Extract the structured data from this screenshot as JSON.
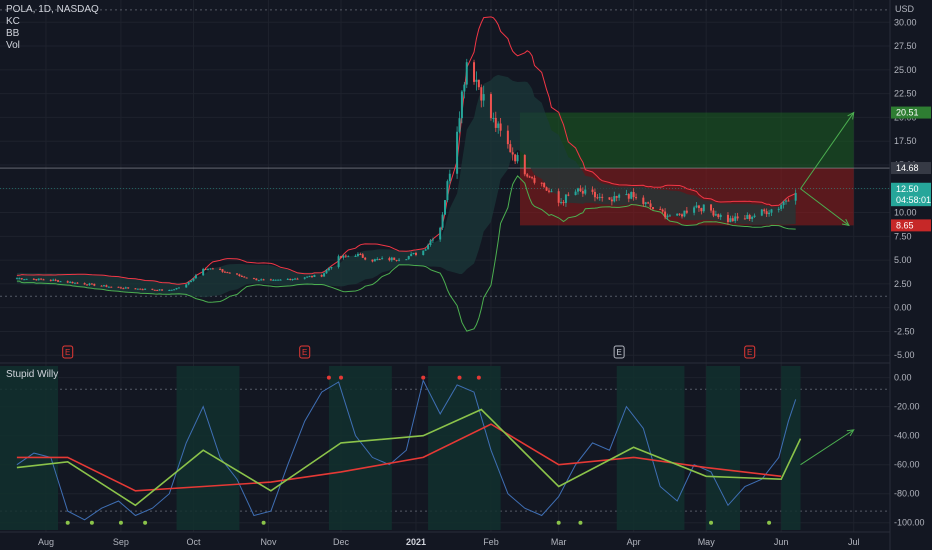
{
  "header": {
    "symbol_line": "POLA, 1D, NASDAQ",
    "indicators": [
      "KC",
      "BB",
      "Vol"
    ],
    "currency": "USD"
  },
  "lower_pane": {
    "title": "Stupid Willy"
  },
  "colors": {
    "background": "#131722",
    "grid": "#1e222d",
    "candle_up": "#26a69a",
    "candle_down": "#ef5350",
    "bb_upper": "#f23645",
    "bb_lower": "#4caf50",
    "kc_fill": "#1b3a3a",
    "signal_red": "#e53935",
    "signal_green": "#8bc34a",
    "osc_blue": "#3f6fb5",
    "profit_zone": "#1b5e20",
    "loss_zone": "#8b1a1a",
    "arrow": "#4caf50"
  },
  "chart_data": [
    {
      "type": "candlestick",
      "title": "POLA, 1D, NASDAQ",
      "xlabel": "",
      "ylabel": "USD",
      "x_ticks": [
        "Aug",
        "Sep",
        "Oct",
        "Nov",
        "Dec",
        "2021",
        "Feb",
        "Mar",
        "Apr",
        "May",
        "Jun",
        "Jul"
      ],
      "y_ticks": [
        "30.00",
        "27.50",
        "25.00",
        "22.50",
        "20.00",
        "17.50",
        "15.00",
        "12.50",
        "10.00",
        "7.50",
        "5.00",
        "2.50",
        "0.00",
        "-2.50",
        "-5.00"
      ],
      "ylim": [
        -5.5,
        31.5
      ],
      "price_tags": [
        {
          "label": "20.51",
          "value": 20.51,
          "color": "#2e7d32"
        },
        {
          "label": "14.68",
          "value": 14.68,
          "color": "#363a45"
        },
        {
          "label": "12.50",
          "value": 12.5,
          "color": "#26a69a"
        },
        {
          "label": "04:58:01",
          "value": 11.3,
          "color": "#26a69a"
        },
        {
          "label": "8.65",
          "value": 8.65,
          "color": "#c62828"
        }
      ],
      "earnings_markers": [
        {
          "label": "E",
          "date": "2020-08-10",
          "style": "red"
        },
        {
          "label": "E",
          "date": "2020-11-16",
          "style": "red"
        },
        {
          "label": "E",
          "date": "2021-03-26",
          "style": "grey"
        },
        {
          "label": "E",
          "date": "2021-05-19",
          "style": "red"
        }
      ],
      "close_series": [
        [
          "2020-07-20",
          3.1
        ],
        [
          "2020-07-27",
          3.0
        ],
        [
          "2020-08-03",
          2.9
        ],
        [
          "2020-08-10",
          2.7
        ],
        [
          "2020-08-17",
          2.5
        ],
        [
          "2020-08-24",
          2.3
        ],
        [
          "2020-08-31",
          2.1
        ],
        [
          "2020-09-07",
          2.0
        ],
        [
          "2020-09-14",
          1.9
        ],
        [
          "2020-09-21",
          1.8
        ],
        [
          "2020-09-28",
          2.4
        ],
        [
          "2020-10-05",
          4.2
        ],
        [
          "2020-10-12",
          3.9
        ],
        [
          "2020-10-19",
          3.4
        ],
        [
          "2020-10-26",
          3.0
        ],
        [
          "2020-11-02",
          2.8
        ],
        [
          "2020-11-09",
          3.0
        ],
        [
          "2020-11-16",
          3.2
        ],
        [
          "2020-11-23",
          3.4
        ],
        [
          "2020-11-30",
          5.2
        ],
        [
          "2020-12-07",
          5.6
        ],
        [
          "2020-12-14",
          5.0
        ],
        [
          "2020-12-21",
          5.1
        ],
        [
          "2020-12-28",
          5.3
        ],
        [
          "2021-01-04",
          6.0
        ],
        [
          "2021-01-11",
          8.5
        ],
        [
          "2021-01-18",
          19.0
        ],
        [
          "2021-01-22",
          26.0
        ],
        [
          "2021-01-26",
          24.0
        ],
        [
          "2021-02-01",
          20.0
        ],
        [
          "2021-02-08",
          17.0
        ],
        [
          "2021-02-15",
          14.5
        ],
        [
          "2021-02-22",
          13.0
        ],
        [
          "2021-03-01",
          11.0
        ],
        [
          "2021-03-08",
          12.2
        ],
        [
          "2021-03-15",
          11.8
        ],
        [
          "2021-03-22",
          11.0
        ],
        [
          "2021-03-29",
          12.0
        ],
        [
          "2021-04-05",
          11.0
        ],
        [
          "2021-04-12",
          10.0
        ],
        [
          "2021-04-19",
          9.5
        ],
        [
          "2021-04-26",
          10.8
        ],
        [
          "2021-05-03",
          10.2
        ],
        [
          "2021-05-10",
          9.2
        ],
        [
          "2021-05-17",
          9.4
        ],
        [
          "2021-05-24",
          10.0
        ],
        [
          "2021-05-31",
          10.6
        ],
        [
          "2021-06-07",
          12.5
        ]
      ],
      "annotations": [
        {
          "type": "projection_arrow",
          "from": [
            "2021-06-09",
            12.5
          ],
          "to": [
            "2021-07-01",
            20.51
          ]
        },
        {
          "type": "projection_arrow",
          "from": [
            "2021-06-09",
            12.5
          ],
          "to": [
            "2021-06-29",
            8.65
          ]
        },
        {
          "type": "target_zone",
          "from_date": "2021-02-13",
          "to_date": "2021-07-01",
          "low": 14.68,
          "high": 20.51
        },
        {
          "type": "stop_zone",
          "from_date": "2021-02-13",
          "to_date": "2021-07-01",
          "low": 8.65,
          "high": 14.68
        }
      ]
    },
    {
      "type": "line",
      "title": "Stupid Willy",
      "xlabel": "",
      "ylabel": "",
      "y_ticks": [
        "0.00",
        "-20.00",
        "-40.00",
        "-60.00",
        "-80.00",
        "-100.00"
      ],
      "ylim": [
        -105,
        8
      ],
      "series": [
        {
          "color": "#3f6fb5",
          "points": [
            [
              "2020-07-20",
              -60
            ],
            [
              "2020-07-27",
              -52
            ],
            [
              "2020-08-03",
              -55
            ],
            [
              "2020-08-10",
              -92
            ],
            [
              "2020-08-17",
              -98
            ],
            [
              "2020-08-24",
              -90
            ],
            [
              "2020-08-31",
              -85
            ],
            [
              "2020-09-07",
              -95
            ],
            [
              "2020-09-14",
              -90
            ],
            [
              "2020-09-21",
              -80
            ],
            [
              "2020-09-28",
              -45
            ],
            [
              "2020-10-05",
              -20
            ],
            [
              "2020-10-12",
              -55
            ],
            [
              "2020-10-19",
              -70
            ],
            [
              "2020-10-26",
              -95
            ],
            [
              "2020-11-02",
              -92
            ],
            [
              "2020-11-09",
              -60
            ],
            [
              "2020-11-16",
              -30
            ],
            [
              "2020-11-23",
              -10
            ],
            [
              "2020-11-30",
              -3
            ],
            [
              "2020-12-07",
              -40
            ],
            [
              "2020-12-14",
              -55
            ],
            [
              "2020-12-21",
              -60
            ],
            [
              "2020-12-28",
              -50
            ],
            [
              "2021-01-04",
              -2
            ],
            [
              "2021-01-11",
              -25
            ],
            [
              "2021-01-18",
              -5
            ],
            [
              "2021-01-25",
              -10
            ],
            [
              "2021-02-01",
              -50
            ],
            [
              "2021-02-08",
              -80
            ],
            [
              "2021-02-15",
              -90
            ],
            [
              "2021-02-22",
              -95
            ],
            [
              "2021-03-01",
              -82
            ],
            [
              "2021-03-08",
              -60
            ],
            [
              "2021-03-15",
              -45
            ],
            [
              "2021-03-22",
              -50
            ],
            [
              "2021-03-29",
              -20
            ],
            [
              "2021-04-05",
              -35
            ],
            [
              "2021-04-12",
              -75
            ],
            [
              "2021-04-19",
              -85
            ],
            [
              "2021-04-26",
              -60
            ],
            [
              "2021-05-03",
              -65
            ],
            [
              "2021-05-10",
              -88
            ],
            [
              "2021-05-17",
              -75
            ],
            [
              "2021-05-24",
              -70
            ],
            [
              "2021-05-31",
              -55
            ],
            [
              "2021-06-04",
              -30
            ],
            [
              "2021-06-07",
              -15
            ]
          ]
        },
        {
          "color": "#e53935",
          "points": [
            [
              "2020-07-20",
              -55
            ],
            [
              "2020-08-10",
              -55
            ],
            [
              "2020-09-07",
              -78
            ],
            [
              "2020-10-05",
              -75
            ],
            [
              "2020-11-02",
              -72
            ],
            [
              "2020-12-01",
              -65
            ],
            [
              "2021-01-04",
              -55
            ],
            [
              "2021-02-01",
              -32
            ],
            [
              "2021-03-01",
              -60
            ],
            [
              "2021-04-01",
              -55
            ],
            [
              "2021-05-01",
              -62
            ],
            [
              "2021-06-01",
              -68
            ]
          ]
        },
        {
          "color": "#8bc34a",
          "points": [
            [
              "2020-07-20",
              -62
            ],
            [
              "2020-08-10",
              -58
            ],
            [
              "2020-09-07",
              -88
            ],
            [
              "2020-10-05",
              -50
            ],
            [
              "2020-11-02",
              -78
            ],
            [
              "2020-12-01",
              -45
            ],
            [
              "2021-01-04",
              -40
            ],
            [
              "2021-01-28",
              -22
            ],
            [
              "2021-03-01",
              -75
            ],
            [
              "2021-04-01",
              -48
            ],
            [
              "2021-05-01",
              -68
            ],
            [
              "2021-06-01",
              -70
            ],
            [
              "2021-06-09",
              -42
            ]
          ]
        }
      ],
      "annotations": [
        {
          "type": "projection_arrow",
          "from": [
            "2021-06-09",
            -60
          ],
          "to": [
            "2021-07-01",
            -36
          ]
        }
      ]
    }
  ]
}
